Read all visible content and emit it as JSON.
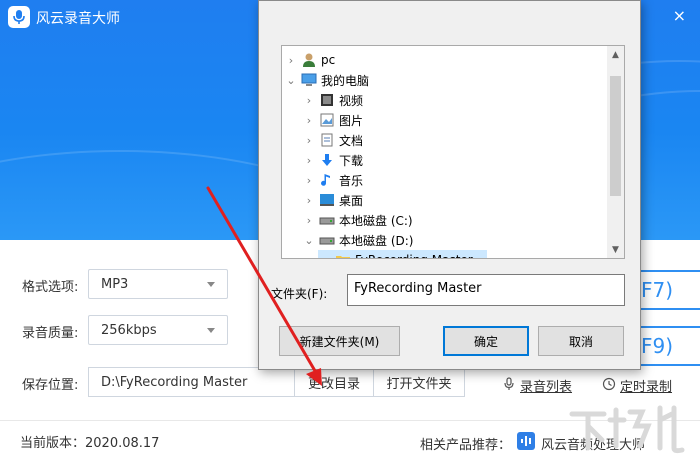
{
  "app": {
    "title": "风云录音大师",
    "close_glyph": "×"
  },
  "form": {
    "format_label": "格式选项:",
    "format_value": "MP3",
    "quality_label": "录音质量:",
    "quality_value": "256kbps",
    "save_label": "保存位置:",
    "save_path": "D:\\FyRecording Master",
    "change_dir": "更改目录",
    "open_folder": "打开文件夹"
  },
  "right_buttons": {
    "f7": "F7)",
    "f9": "F9)"
  },
  "links": {
    "record_list": "录音列表",
    "timed_record": "定时录制"
  },
  "footer": {
    "version": "当前版本：2020.08.17",
    "related_label": "相关产品推荐：",
    "related_product": "风云音频处理大师"
  },
  "dialog": {
    "tree": [
      {
        "label": "pc",
        "icon": "user-icon",
        "level": 0,
        "chevron": "›"
      },
      {
        "label": "我的电脑",
        "icon": "computer-icon",
        "level": 0,
        "chevron": "⌄"
      },
      {
        "label": "视频",
        "icon": "video-icon",
        "level": 1,
        "chevron": "›"
      },
      {
        "label": "图片",
        "icon": "picture-icon",
        "level": 1,
        "chevron": "›"
      },
      {
        "label": "文档",
        "icon": "document-icon",
        "level": 1,
        "chevron": "›"
      },
      {
        "label": "下载",
        "icon": "download-icon",
        "level": 1,
        "chevron": "›"
      },
      {
        "label": "音乐",
        "icon": "music-icon",
        "level": 1,
        "chevron": "›"
      },
      {
        "label": "桌面",
        "icon": "desktop-icon",
        "level": 1,
        "chevron": "›"
      },
      {
        "label": "本地磁盘 (C:)",
        "icon": "drive-icon",
        "level": 1,
        "chevron": "›"
      },
      {
        "label": "本地磁盘 (D:)",
        "icon": "drive-icon",
        "level": 1,
        "chevron": "⌄"
      },
      {
        "label": "FyRecording Master",
        "icon": "folder-icon",
        "level": 2,
        "chevron": ""
      }
    ],
    "folder_label": "文件夹(F):",
    "folder_value": "FyRecording Master",
    "new_folder": "新建文件夹(M)",
    "ok": "确定",
    "cancel": "取消"
  },
  "colors": {
    "accent": "#1f7ef0",
    "arrow": "#e02020"
  }
}
